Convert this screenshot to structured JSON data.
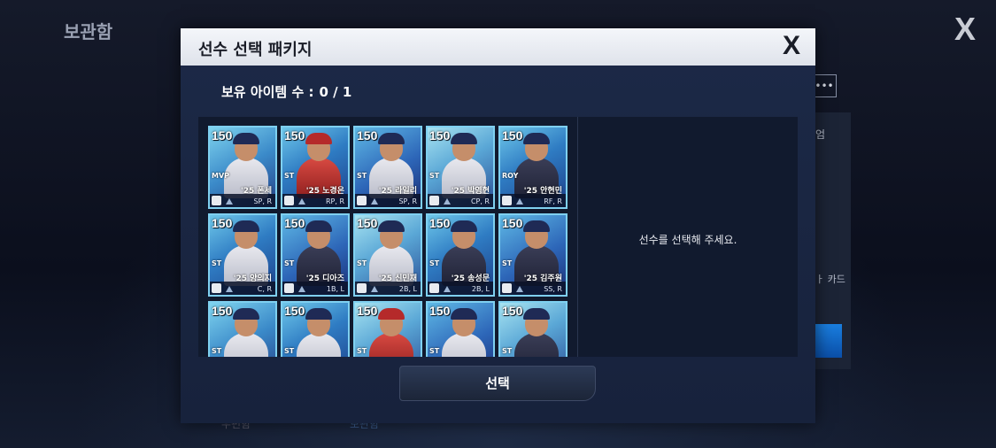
{
  "background": {
    "title": "보관함",
    "close_label": "X",
    "more_label": "•••",
    "side_text_1": "엄",
    "side_text_2": "ㅏ 카드",
    "tab_left": "우편함",
    "tab_right": "보관함"
  },
  "modal": {
    "title": "선수 선택 패키지",
    "close_label": "X",
    "owned_label": "보유 아이템 수 :",
    "owned_value": "0 / 1",
    "empty_message": "선수를 선택해 주세요.",
    "select_button": "선택"
  },
  "cards": [
    {
      "rating": "150",
      "badge": "MVP",
      "name": "'25 폰세",
      "pos": "SP, R"
    },
    {
      "rating": "150",
      "badge": "ST",
      "name": "'25 노경은",
      "pos": "RP, R"
    },
    {
      "rating": "150",
      "badge": "ST",
      "name": "'25 라일리",
      "pos": "SP, R"
    },
    {
      "rating": "150",
      "badge": "ST",
      "name": "'25 박영현",
      "pos": "CP, R"
    },
    {
      "rating": "150",
      "badge": "ROY",
      "name": "'25 안현민",
      "pos": "RF, R"
    },
    {
      "rating": "150",
      "badge": "ST",
      "name": "'25 양의지",
      "pos": "C, R"
    },
    {
      "rating": "150",
      "badge": "ST",
      "name": "'25 디아즈",
      "pos": "1B, L"
    },
    {
      "rating": "150",
      "badge": "ST",
      "name": "'25 신민재",
      "pos": "2B, L"
    },
    {
      "rating": "150",
      "badge": "ST",
      "name": "'25 송성문",
      "pos": "2B, L"
    },
    {
      "rating": "150",
      "badge": "ST",
      "name": "'25 김주원",
      "pos": "SS, R"
    },
    {
      "rating": "150",
      "badge": "ST",
      "name": "",
      "pos": ""
    },
    {
      "rating": "150",
      "badge": "ST",
      "name": "",
      "pos": ""
    },
    {
      "rating": "150",
      "badge": "ST",
      "name": "",
      "pos": ""
    },
    {
      "rating": "150",
      "badge": "ST",
      "name": "",
      "pos": ""
    },
    {
      "rating": "150",
      "badge": "ST",
      "name": "",
      "pos": ""
    }
  ],
  "colors": {
    "modal_bg": "#1c2947",
    "header_bg": "#f4f6fa",
    "card_border": "#7fd0f0"
  }
}
